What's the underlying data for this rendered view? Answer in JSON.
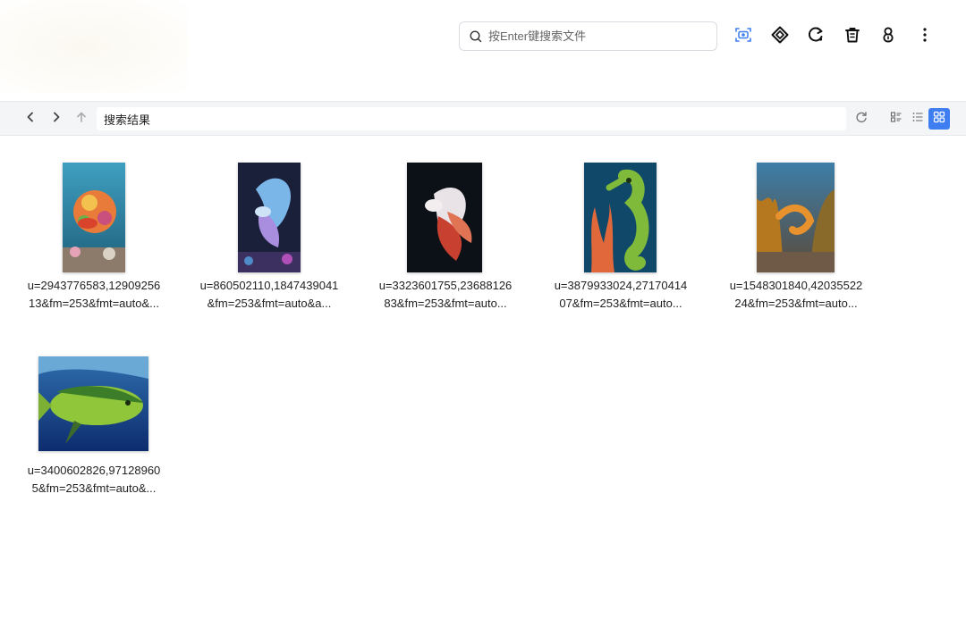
{
  "search": {
    "placeholder": "按Enter键搜索文件"
  },
  "toolbar": {
    "tools": [
      {
        "icon": "camera-scan-icon",
        "label": "image search"
      },
      {
        "icon": "diamond-icon",
        "label": "apps"
      },
      {
        "icon": "refresh-search-icon",
        "label": "sync"
      },
      {
        "icon": "trash-icon",
        "label": "trash"
      },
      {
        "icon": "user-icon",
        "label": "account"
      },
      {
        "icon": "more-vertical-icon",
        "label": "more"
      }
    ]
  },
  "pathbar": {
    "path": "搜索结果",
    "view_mode": "grid"
  },
  "files": [
    {
      "line1": "u=2943776583,12909256",
      "line2": "13&fm=253&fmt=auto&..."
    },
    {
      "line1": "u=860502110,1847439041",
      "line2": "&fm=253&fmt=auto&a..."
    },
    {
      "line1": "u=3323601755,23688126",
      "line2": "83&fm=253&fmt=auto..."
    },
    {
      "line1": "u=3879933024,27170414",
      "line2": "07&fm=253&fmt=auto..."
    },
    {
      "line1": "u=1548301840,42035522",
      "line2": "24&fm=253&fmt=auto..."
    },
    {
      "line1": "u=3400602826,97128960",
      "line2": "5&fm=253&fmt=auto&..."
    }
  ],
  "colors": {
    "accent": "#3f7ef0",
    "toolbar_bg": "#f4f5f7",
    "border": "#e6e8eb"
  }
}
